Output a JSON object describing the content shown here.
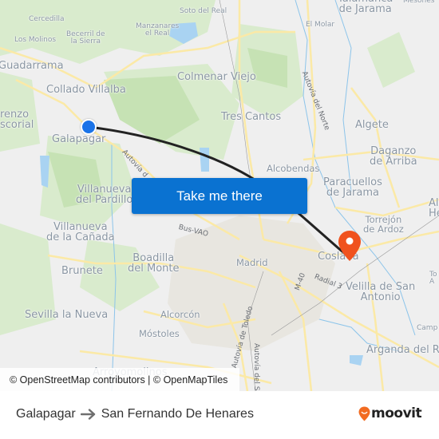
{
  "map": {
    "places": [
      {
        "name": "Cercedilla",
        "size": "sm"
      },
      {
        "name": "Los Molinos",
        "size": "sm"
      },
      {
        "name": "Becerril de la Sierra",
        "line1": "Becerril de",
        "line2": "la Sierra",
        "size": "sm"
      },
      {
        "name": "Manzanares el Real",
        "line1": "Manzanares",
        "line2": "el Real",
        "size": "sm"
      },
      {
        "name": "Soto del Real",
        "size": "sm"
      },
      {
        "name": "Guadarrama",
        "size": "lg"
      },
      {
        "name": "Collado Villalba",
        "size": "lg"
      },
      {
        "name": "Colmenar Viejo",
        "size": "lg"
      },
      {
        "name": "San Lorenzo de El Escorial",
        "line1": "renzo",
        "line2": "scorial",
        "size": "lg"
      },
      {
        "name": "Galapagar",
        "size": "lg"
      },
      {
        "name": "Tres Cantos",
        "size": "lg"
      },
      {
        "name": "Talamanca de Jarama",
        "line1": "Talamanca",
        "line2": "de Jarama",
        "size": "lg"
      },
      {
        "name": "Mesones",
        "size": "sm"
      },
      {
        "name": "El Molar",
        "size": "sm"
      },
      {
        "name": "Algete",
        "size": "lg"
      },
      {
        "name": "Daganzo de Arriba",
        "line1": "Daganzo",
        "line2": "de Arriba",
        "size": "lg"
      },
      {
        "name": "Alcobendas",
        "size": "md"
      },
      {
        "name": "Paracuellos de Jarama",
        "line1": "Paracuellos",
        "line2": "de Jarama",
        "size": "lg"
      },
      {
        "name": "Alcalá de Henares",
        "line1": "Alc",
        "line2": "He",
        "size": "lg"
      },
      {
        "name": "Villanueva del Pardillo",
        "line1": "Villanueva",
        "line2": "del Pardillo",
        "size": "lg"
      },
      {
        "name": "Villanueva de la Cañada",
        "line1": "Villanueva",
        "line2": "de la Cañada",
        "size": "lg"
      },
      {
        "name": "Torrejón de Ardoz",
        "line1": "Torrejón",
        "line2": "de Ardoz",
        "size": "md"
      },
      {
        "name": "Boadilla del Monte",
        "line1": "Boadilla",
        "line2": "del Monte",
        "size": "lg"
      },
      {
        "name": "Madrid",
        "size": "md"
      },
      {
        "name": "Coslada",
        "size": "lg"
      },
      {
        "name": "Brunete",
        "size": "lg"
      },
      {
        "name": "Velilla de San Antonio",
        "line1": "Velilla de San",
        "line2": "Antonio",
        "size": "lg"
      },
      {
        "name": "Torres de la Alameda",
        "line1": "To",
        "line2": "A",
        "size": "sm"
      },
      {
        "name": "Sevilla la Nueva",
        "size": "lg"
      },
      {
        "name": "Alcorcón",
        "size": "md"
      },
      {
        "name": "Móstoles",
        "size": "md"
      },
      {
        "name": "Campo Real",
        "line1": "Camp",
        "size": "sm"
      },
      {
        "name": "Arganda del Rey",
        "line1": "Arganda del Re",
        "size": "lg"
      },
      {
        "name": "Arroyomolinos",
        "size": "lg"
      }
    ],
    "roads": [
      {
        "name": "Autovía del Norte"
      },
      {
        "name": "Autovía de Guadarrama",
        "text": "Autovía d"
      },
      {
        "name": "Bus-VAO"
      },
      {
        "name": "M-40"
      },
      {
        "name": "Radial 3"
      },
      {
        "name": "Autovía de Toledo"
      },
      {
        "name": "Autovía del Sur",
        "text": "Autovía del S"
      }
    ],
    "origin_marker": "Galapagar",
    "destination_marker": "San Fernando De Henares",
    "route_color": "#222222",
    "origin_color": "#1a73e8",
    "destination_color": "#f0521e"
  },
  "cta": {
    "label": "Take me there",
    "color": "#0a72d1"
  },
  "attribution": {
    "text": "© OpenStreetMap contributors | © OpenMapTiles"
  },
  "footer": {
    "origin": "Galapagar",
    "destination": "San Fernando De Henares",
    "arrow_icon": "arrow-right-icon",
    "brand": "moovit",
    "brand_color": "#f26b21"
  }
}
